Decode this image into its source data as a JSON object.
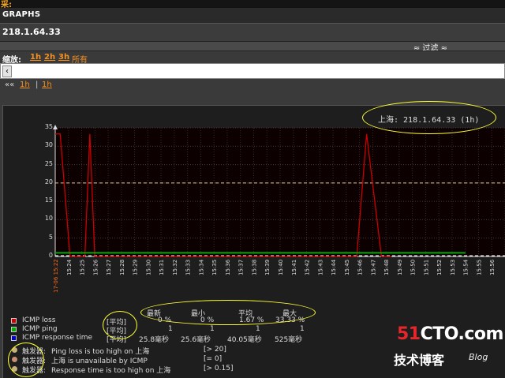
{
  "top": {
    "fragment": "采:"
  },
  "header": {
    "title": "GRAPHS"
  },
  "host": {
    "address": "218.1.64.33"
  },
  "filter": {
    "label": "≈ 过滤 ≈"
  },
  "zoom": {
    "label": "缩放:",
    "options": [
      "1h",
      "2h",
      "3h",
      "所有"
    ]
  },
  "scroll": {
    "left_glyph": "‹"
  },
  "nav": {
    "prev": "««",
    "link1": "1h",
    "sep": "|",
    "link2": "1h"
  },
  "graph_title": "上海: 218.1.64.33 (1h)",
  "legend": {
    "headers": [
      "最新",
      "最小",
      "平均",
      "最大"
    ],
    "items": [
      {
        "name": "ICMP loss",
        "agg": "[平均]",
        "last": "0 %",
        "min": "0 %",
        "avg": "1.67 %",
        "max": "33.33 %",
        "color": "#cc0000"
      },
      {
        "name": "ICMP ping",
        "agg": "[平均]",
        "last": "1",
        "min": "1",
        "avg": "1",
        "max": "1",
        "color": "#00aa00"
      },
      {
        "name": "ICMP response time",
        "agg": "[平均]",
        "last": "25.8毫秒",
        "min": "25.6毫秒",
        "avg": "40.05毫秒",
        "max": "525毫秒",
        "color": "#0000cc"
      }
    ],
    "triggers": [
      {
        "label": "触发器:",
        "text": "Ping loss is too high on 上海",
        "cond": "[> 20]"
      },
      {
        "label": "触发器:",
        "text": "上海 is unavailable by ICMP",
        "cond": "[= 0]"
      },
      {
        "label": "触发器:",
        "text": "Response time is too high on 上海",
        "cond": "[> 0.15]"
      }
    ]
  },
  "watermark": {
    "brand_prefix": "51",
    "brand_suffix": "CTO.com",
    "subtitle": "技术博客",
    "blog": "Blog"
  },
  "chart_data": {
    "type": "line",
    "y_ticks": [
      "0",
      "5",
      "10",
      "15",
      "20",
      "25",
      "30",
      "35"
    ],
    "ylim": [
      0,
      35
    ],
    "x_first_label": "17-06 15:22",
    "x_labels": [
      "15:24",
      "15:25",
      "15:26",
      "15:27",
      "15:28",
      "15:29",
      "15:30",
      "15:31",
      "15:32",
      "15:33",
      "15:34",
      "15:35",
      "15:36",
      "15:37",
      "15:38",
      "15:39",
      "15:40",
      "15:41",
      "15:42",
      "15:43",
      "15:44",
      "15:45",
      "15:46",
      "15:47",
      "15:48",
      "15:49",
      "15:50",
      "15:51",
      "15:52",
      "15:53",
      "15:54",
      "15:55",
      "15:56"
    ],
    "trigger_level": 20,
    "series": [
      {
        "name": "ICMP loss",
        "color": "#cc0000",
        "x": [
          15.37,
          15.38,
          15.4,
          15.43,
          15.44,
          15.45,
          15.47,
          15.98,
          16.0,
          16.03,
          16.05
        ],
        "y": [
          33.33,
          33.33,
          0,
          0,
          33.33,
          0,
          0,
          0,
          33.33,
          0,
          0
        ]
      },
      {
        "name": "ICMP ping",
        "color": "#00aa00",
        "x": [
          15.37,
          16.2
        ],
        "y": [
          1,
          1
        ]
      }
    ]
  }
}
